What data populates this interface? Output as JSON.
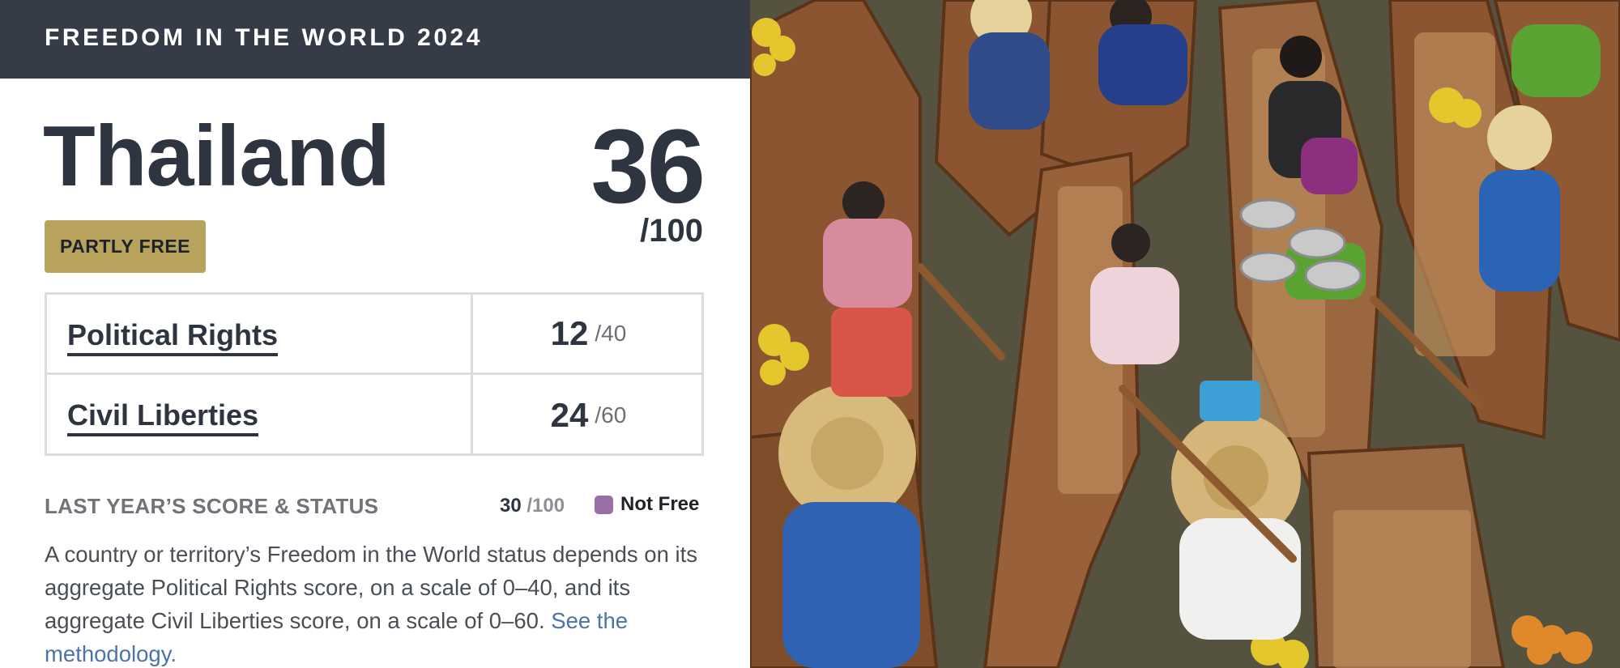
{
  "header": {
    "title": "FREEDOM IN THE WORLD 2024"
  },
  "country": {
    "name": "Thailand",
    "total_score": "36",
    "total_denom": "/100",
    "status": "PARTLY FREE"
  },
  "categories": [
    {
      "label": "Political Rights",
      "score": "12",
      "denom": "/40"
    },
    {
      "label": "Civil Liberties",
      "score": "24",
      "denom": "/60"
    }
  ],
  "last_year": {
    "label": "LAST YEAR’S SCORE & STATUS",
    "score": "30",
    "denom": "/100",
    "status": "Not Free",
    "status_color": "#9a6fa8"
  },
  "description": {
    "text": "A country or territory’s Freedom in the World status depends on its aggregate Political Rights score, on a scale of 0–40, and its aggregate Civil Liberties score, on a scale of 0–60. ",
    "link_text": "See the methodology."
  },
  "colors": {
    "header_bg": "#363c47",
    "badge_partly_free": "#b8a35c",
    "link": "#4b74a8"
  }
}
